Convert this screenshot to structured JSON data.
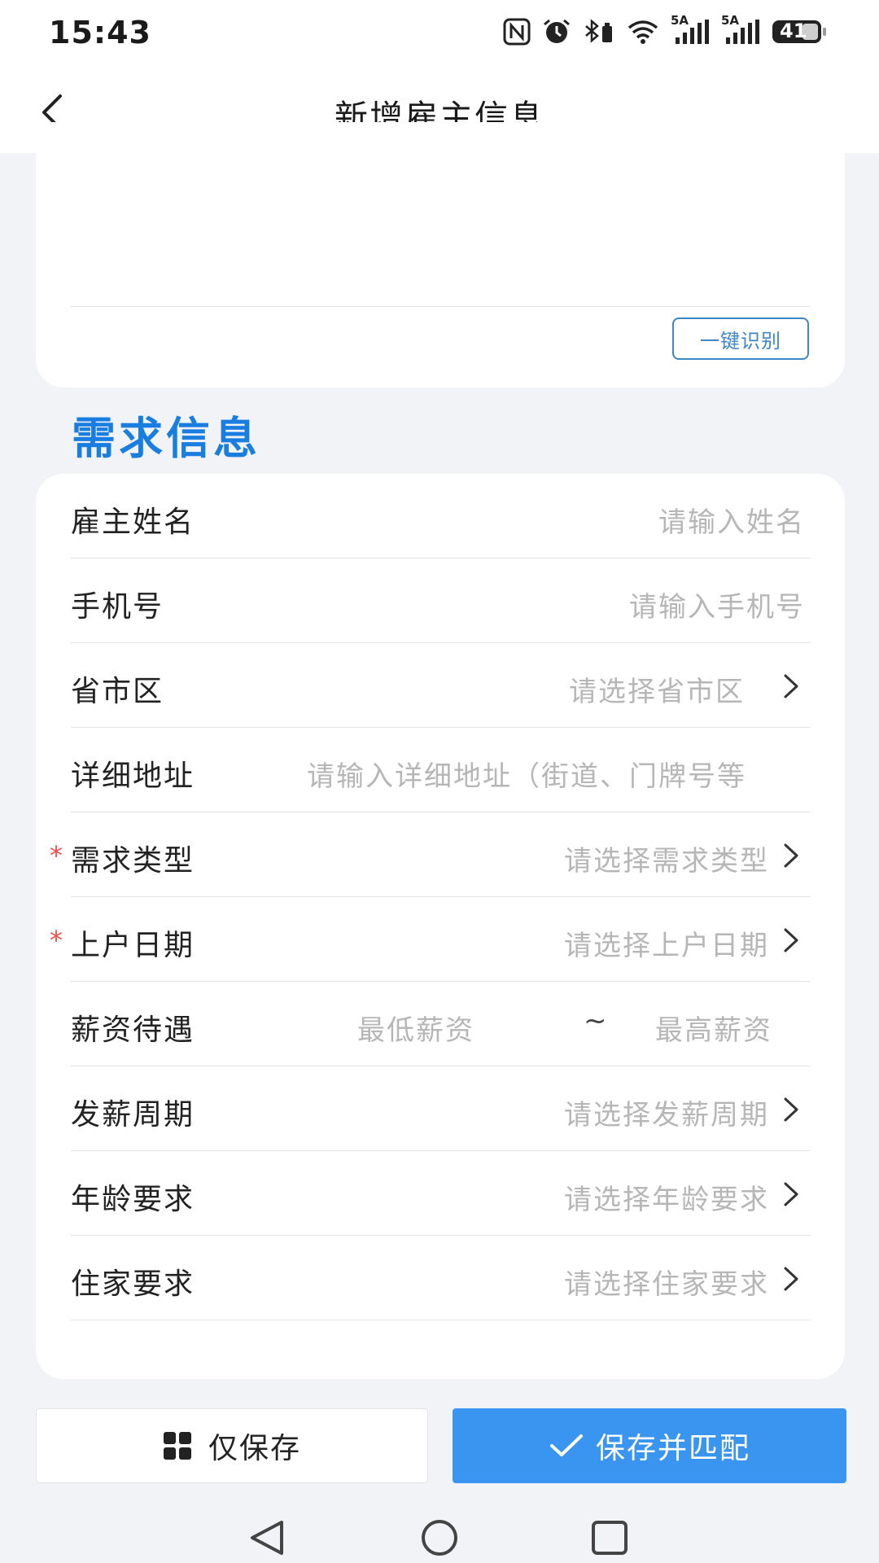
{
  "status_bar": {
    "time": "15:43",
    "network_1": "5A",
    "network_2": "5A",
    "battery": "41",
    "icons": [
      "nfc-icon",
      "alarm-icon",
      "bluetooth-battery-icon",
      "wifi-icon",
      "signal-icon",
      "signal-icon",
      "battery-icon"
    ]
  },
  "nav": {
    "back_icon": "chevron-left-icon",
    "title": "新增雇主信息"
  },
  "top_card": {
    "recognize_button": "一键识别"
  },
  "section": {
    "title": "需求信息"
  },
  "form": {
    "rows": [
      {
        "label": "雇主姓名",
        "value": "请输入姓名",
        "required": false,
        "arrow": false
      },
      {
        "label": "手机号",
        "value": "请输入手机号",
        "required": false,
        "arrow": false
      },
      {
        "label": "省市区",
        "value": "请选择省市区",
        "required": false,
        "arrow": true
      },
      {
        "label": "详细地址",
        "value": "请输入详细地址（街道、门牌号等",
        "required": false,
        "arrow": false
      },
      {
        "label": "需求类型",
        "value": "请选择需求类型",
        "required": true,
        "arrow": true
      },
      {
        "label": "上户日期",
        "value": "请选择上户日期",
        "required": true,
        "arrow": true
      },
      {
        "label": "薪资待遇",
        "min": "最低薪资",
        "separator": "~",
        "max": "最高薪资"
      },
      {
        "label": "发薪周期",
        "value": "请选择发薪周期",
        "required": false,
        "arrow": true
      },
      {
        "label": "年龄要求",
        "value": "请选择年龄要求",
        "required": false,
        "arrow": true
      },
      {
        "label": "住家要求",
        "value": "请选择住家要求",
        "required": false,
        "arrow": true
      }
    ],
    "required_mark": "*"
  },
  "actions": {
    "save_only": "仅保存",
    "save_and_match": "保存并匹配"
  },
  "colors": {
    "accent_blue": "#1a7ee0",
    "button_blue": "#3a95f0",
    "required_red": "#ee4e4e",
    "placeholder_gray": "#b6b6b6",
    "page_bg": "#f2f3f6"
  }
}
